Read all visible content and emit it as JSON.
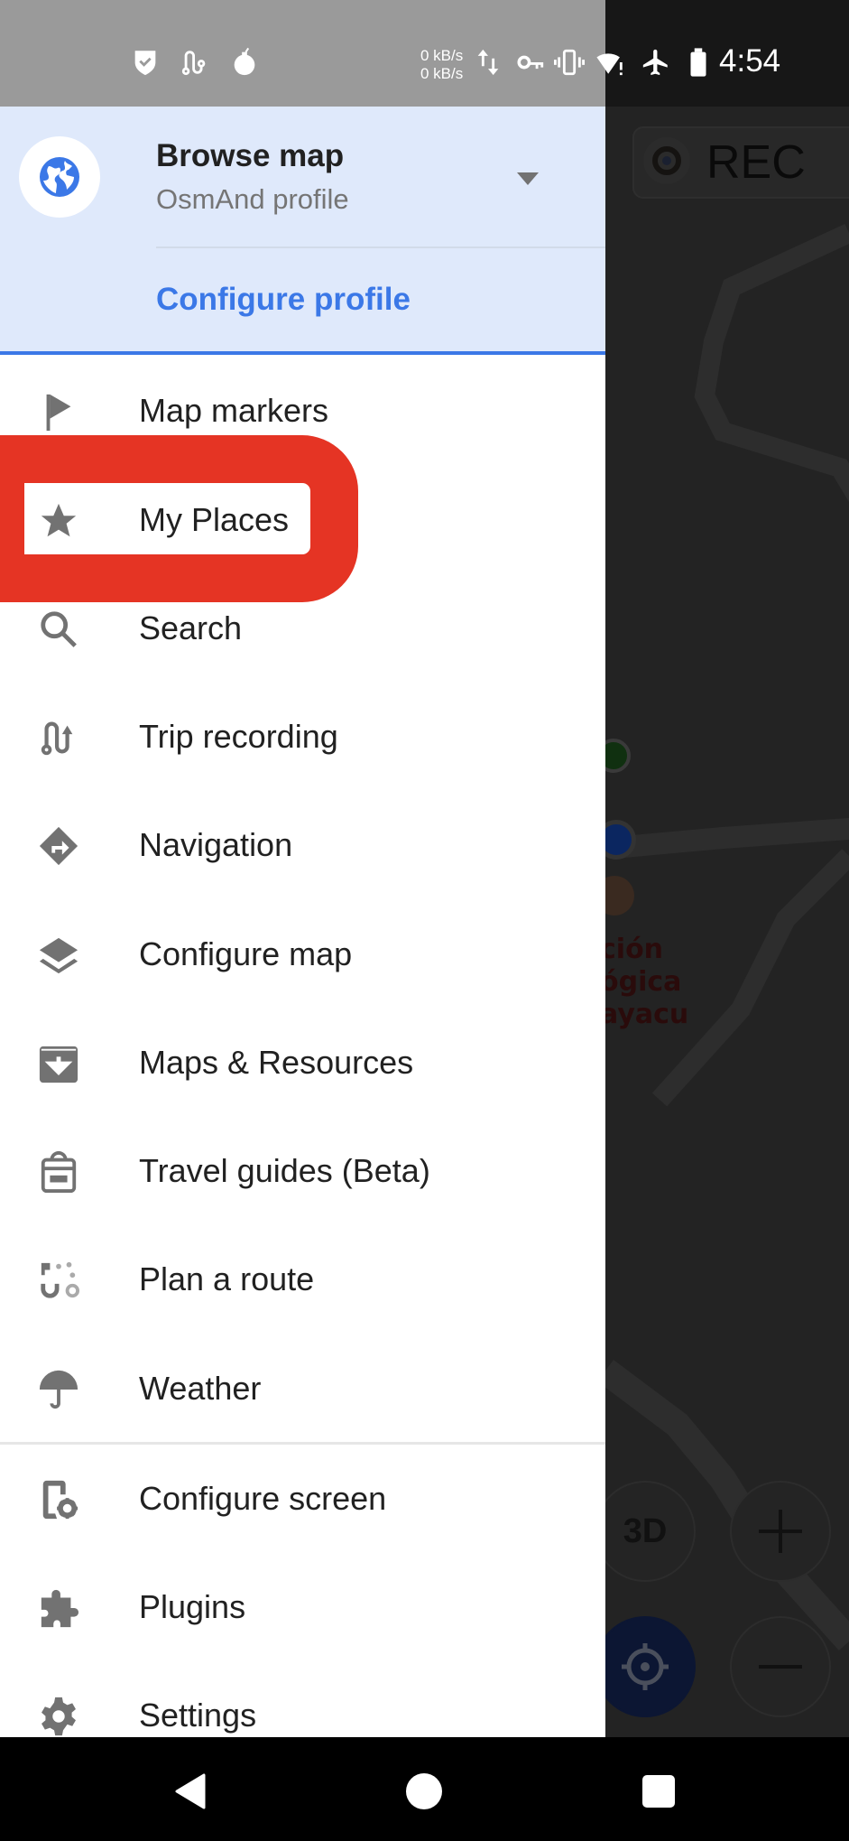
{
  "status_bar": {
    "left_icons": [
      "shield-check-icon",
      "route-icon",
      "bomb-icon"
    ],
    "net_speed_up": "0 kB/s",
    "net_speed_down": "0 kB/s",
    "right_icons": [
      "data-arrows-icon",
      "vpn-key-icon",
      "vibrate-icon",
      "wifi-alert-icon",
      "airplane-icon",
      "battery-icon"
    ],
    "time": "4:54"
  },
  "drawer": {
    "header": {
      "avatar_icon": "globe-icon",
      "title": "Browse map",
      "subtitle": "OsmAnd profile",
      "dropdown_icon": "triangle-down-icon",
      "configure_profile_label": "Configure profile"
    },
    "items": [
      {
        "label": "Map markers",
        "icon": "flag-icon"
      },
      {
        "label": "My Places",
        "icon": "star-icon"
      },
      {
        "label": "Search",
        "icon": "search-icon"
      },
      {
        "label": "Trip recording",
        "icon": "trip-recording-icon"
      },
      {
        "label": "Navigation",
        "icon": "navigation-icon"
      },
      {
        "label": "Configure map",
        "icon": "layers-icon"
      },
      {
        "label": "Maps & Resources",
        "icon": "download-box-icon"
      },
      {
        "label": "Travel guides (Beta)",
        "icon": "backpack-icon"
      },
      {
        "label": "Plan a route",
        "icon": "plan-route-icon"
      },
      {
        "label": "Weather",
        "icon": "umbrella-icon"
      }
    ],
    "secondary_items": [
      {
        "label": "Configure screen",
        "icon": "configure-screen-icon"
      },
      {
        "label": "Plugins",
        "icon": "puzzle-icon"
      },
      {
        "label": "Settings",
        "icon": "gear-icon"
      }
    ]
  },
  "map": {
    "rec_label": "REC",
    "poi_text": [
      "ción",
      "ógica",
      "ayacu"
    ],
    "btn_3d_label": "3D"
  },
  "annotation": {
    "highlighted_item": "My Places",
    "color": "#e53424"
  },
  "colors": {
    "accent": "#3b78e7",
    "header_bg": "#dfe9fb",
    "icon_gray": "#727272"
  },
  "nav_bar": {
    "buttons": [
      "back",
      "home",
      "recents"
    ]
  }
}
